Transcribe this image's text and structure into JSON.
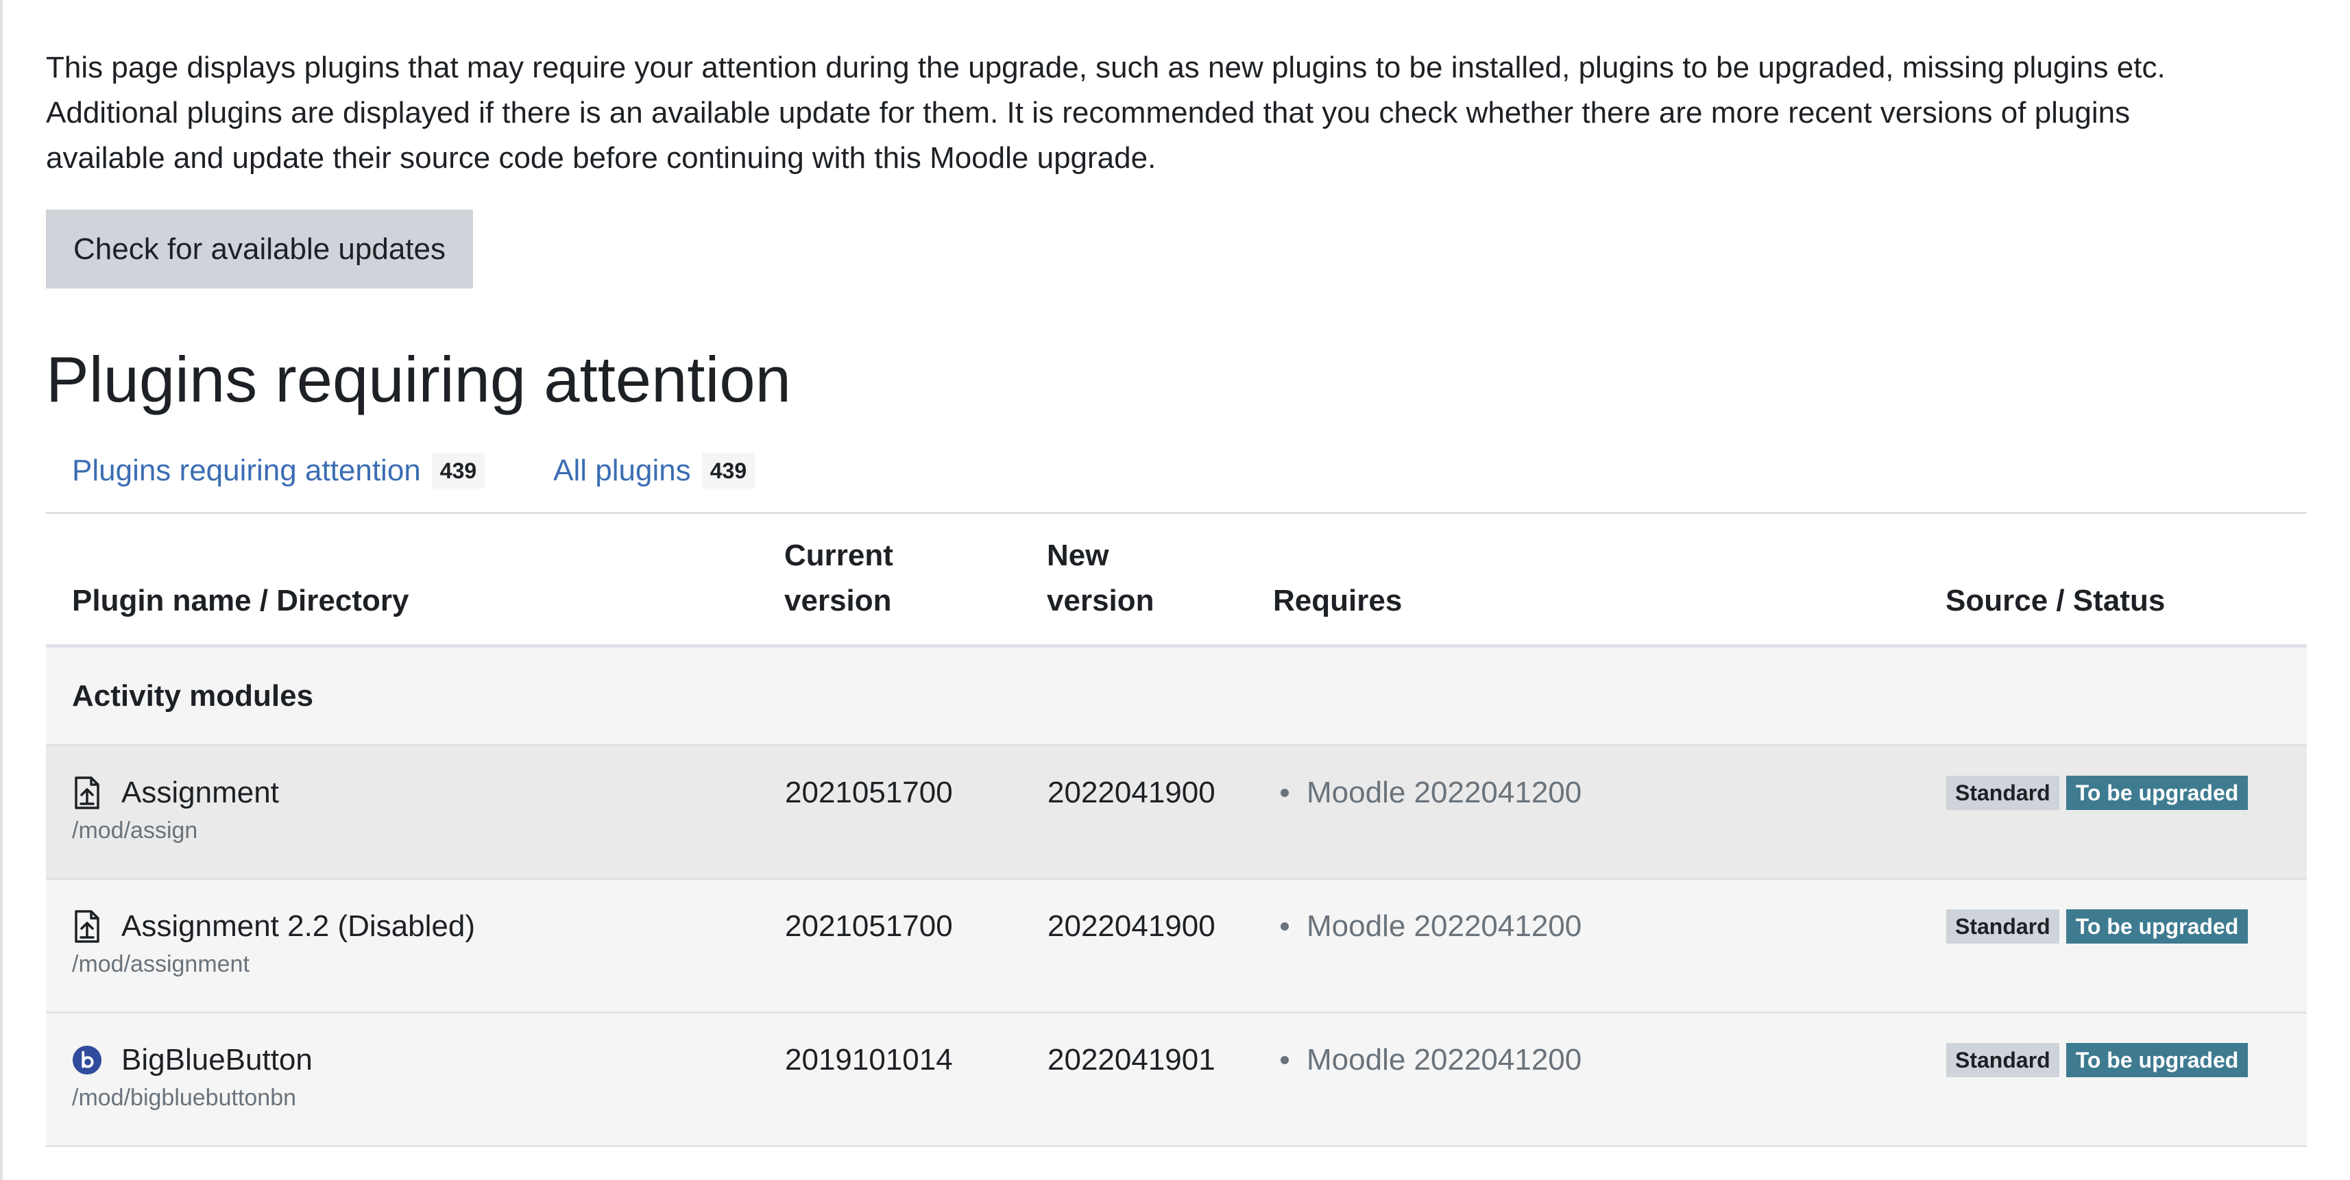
{
  "intro": {
    "line1": "This page displays plugins that may require your attention during the upgrade, such as new plugins to be installed, plugins to be upgraded, missing plugins etc.",
    "line2": "Additional plugins are displayed if there is an available update for them. It is recommended that you check whether there are more recent versions of plugins",
    "line3": "available and update their source code before continuing with this Moodle upgrade."
  },
  "check_button": "Check for available updates",
  "heading": "Plugins requiring attention",
  "tabs": [
    {
      "label": "Plugins requiring attention",
      "count": "439"
    },
    {
      "label": "All plugins",
      "count": "439"
    }
  ],
  "table": {
    "headers": {
      "name": "Plugin name / Directory",
      "current_line1": "Current",
      "current_line2": "version",
      "new_line1": "New",
      "new_line2": "version",
      "requires": "Requires",
      "source": "Source / Status"
    },
    "group": "Activity modules",
    "rows": [
      {
        "icon": "assignment-icon",
        "name": "Assignment",
        "dir": "/mod/assign",
        "current": "2021051700",
        "new": "2022041900",
        "requires": "Moodle 2022041200",
        "source": "Standard",
        "status": "To be upgraded"
      },
      {
        "icon": "assignment-icon",
        "name": "Assignment 2.2 (Disabled)",
        "dir": "/mod/assignment",
        "current": "2021051700",
        "new": "2022041900",
        "requires": "Moodle 2022041200",
        "source": "Standard",
        "status": "To be upgraded"
      },
      {
        "icon": "bigbluebutton-icon",
        "name": "BigBlueButton",
        "dir": "/mod/bigbluebuttonbn",
        "current": "2019101014",
        "new": "2022041901",
        "requires": "Moodle 2022041200",
        "source": "Standard",
        "status": "To be upgraded"
      }
    ]
  },
  "colors": {
    "link": "#3b6db3",
    "upgrade_badge": "#3e7b90",
    "standard_badge": "#ced4da",
    "bbb_icon": "#2f4b9c"
  }
}
